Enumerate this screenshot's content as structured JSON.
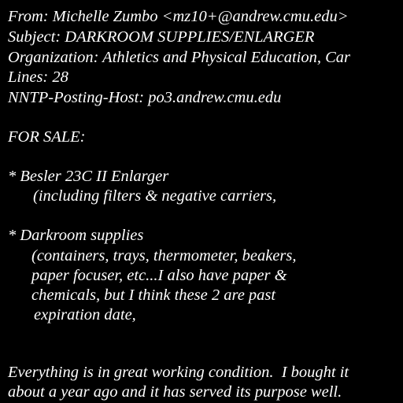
{
  "colors": {
    "background": "#000000",
    "text": "#ffffff"
  },
  "header": {
    "from": "From: Michelle Zumbo <mz10+@andrew.cmu.edu>",
    "subject": "Subject: DARKROOM SUPPLIES/ENLARGER",
    "organization": "Organization: Athletics and Physical Education, Car",
    "lines": "Lines: 28",
    "posting_host": "NNTP-Posting-Host: po3.andrew.cmu.edu"
  },
  "body": {
    "for_sale": "FOR SALE:",
    "item1_title": "* Besler 23C II Enlarger",
    "item1_detail": "(including filters & negative carriers,",
    "item2_title": "* Darkroom supplies",
    "item2_detail_1": "(containers, trays, thermometer, beakers,",
    "item2_detail_2": "paper focuser, etc...I also have paper &",
    "item2_detail_3": "chemicals, but I think these 2 are past",
    "item2_detail_4": "expiration date,",
    "condition_1": "Everything is in great working condition.  I bought it",
    "condition_2": "about a year ago and it has served its purpose well."
  }
}
